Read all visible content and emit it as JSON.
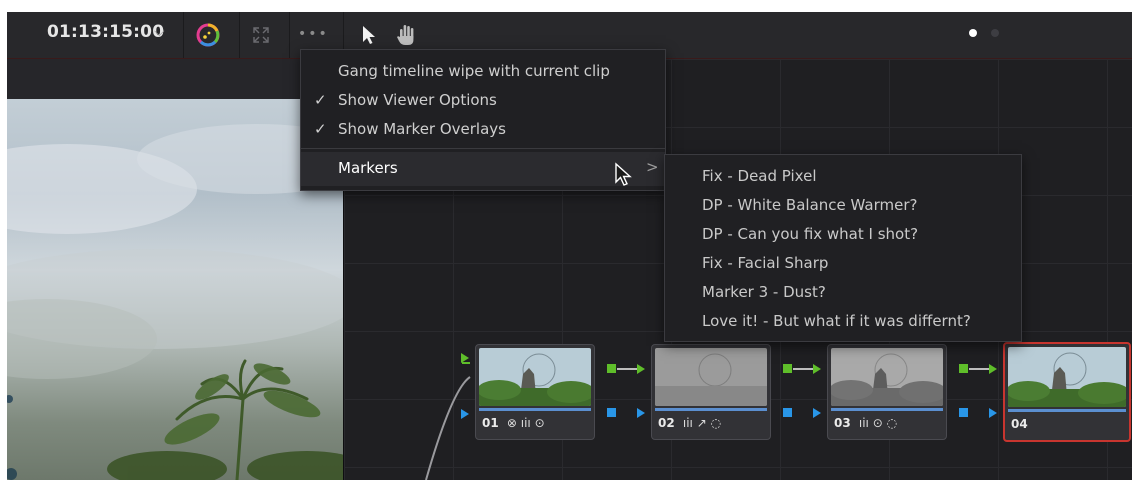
{
  "toolbar": {
    "timecode": "01:13:15:00",
    "timecode_chevron": "⌵",
    "icons": [
      "color-wheel-icon",
      "expand-icon",
      "more-options-icon",
      "pointer-icon",
      "hand-icon"
    ],
    "more_label": "•••"
  },
  "page_indicator": {
    "active_color": "#ffffff",
    "inactive_color": "#4a4a4f"
  },
  "viewer_menu": {
    "items": [
      {
        "label": "Gang timeline wipe with current clip",
        "checked": false
      },
      {
        "label": "Show Viewer Options",
        "checked": true
      },
      {
        "label": "Show Marker Overlays",
        "checked": true
      }
    ],
    "check_glyph": "✓",
    "markers_label": "Markers",
    "submenu_arrow": ">"
  },
  "markers_submenu": {
    "items": [
      "Fix - Dead Pixel",
      "DP - White Balance Warmer?",
      "DP - Can you fix what I shot?",
      "Fix - Facial Sharp",
      "Marker 3 - Dust?",
      "Love it! - But what if it was differnt?"
    ]
  },
  "nodes": [
    {
      "number": "01",
      "tools": "⊗ ıiı ⊙",
      "selected": false
    },
    {
      "number": "02",
      "tools": "ıiı ↗ ◌",
      "selected": false
    },
    {
      "number": "03",
      "tools": "ıiı ⊙ ◌",
      "selected": false
    },
    {
      "number": "04",
      "tools": "",
      "selected": true
    }
  ],
  "colors": {
    "rgb_port": "#5fbe2a",
    "alpha_port": "#2996e8",
    "selected_outline": "#c8352f",
    "node_bar": "#5b8fd0"
  }
}
